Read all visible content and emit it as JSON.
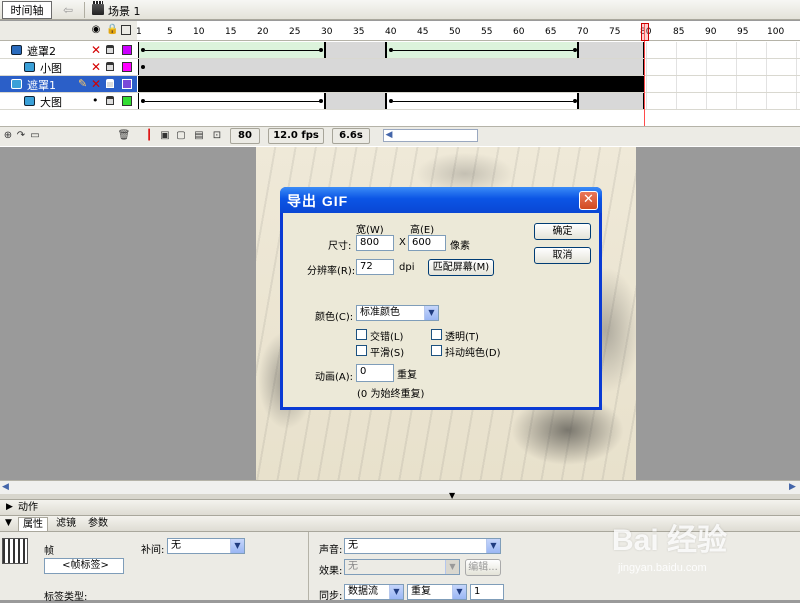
{
  "toolbar": {
    "timeline_label": "时间轴",
    "scene_label": "场景 1"
  },
  "timeline": {
    "ruler_ticks": [
      "1",
      "5",
      "10",
      "15",
      "20",
      "25",
      "30",
      "35",
      "40",
      "45",
      "50",
      "55",
      "60",
      "65",
      "70",
      "75",
      "80",
      "85",
      "90",
      "95",
      "100"
    ],
    "current_frame": "80",
    "fps": "12.0 fps",
    "elapsed": "6.6s",
    "layers": [
      {
        "name": "遮罩2",
        "type": "mask",
        "color": "#cc00ff"
      },
      {
        "name": "小图",
        "type": "masked",
        "color": "#ff00ff"
      },
      {
        "name": "遮罩1",
        "type": "mask",
        "color": "#7b49d9",
        "selected": true
      },
      {
        "name": "大图",
        "type": "masked",
        "color": "#33dd33"
      }
    ]
  },
  "dialog": {
    "title": "导出 GIF",
    "width_header": "宽(W)",
    "height_header": "高(E)",
    "size_label": "尺寸:",
    "width_value": "800",
    "x_label": "X",
    "height_value": "600",
    "pixel_unit": "像素",
    "resolution_label": "分辨率(R):",
    "resolution_value": "72",
    "dpi_unit": "dpi",
    "match_screen_button": "匹配屏幕(M)",
    "ok_button": "确定",
    "cancel_button": "取消",
    "colors_label": "颜色(C):",
    "colors_value": "标准颜色",
    "interlace_label": "交错(L)",
    "transparent_label": "透明(T)",
    "smooth_label": "平滑(S)",
    "dither_label": "抖动纯色(D)",
    "animation_label": "动画(A):",
    "animation_value": "0",
    "repeat_label": "重复",
    "repeat_note": "(0 为始终重复)"
  },
  "panels": {
    "actions_tab": "动作",
    "properties_tab": "属性",
    "filters_tab": "滤镜",
    "parameters_tab": "参数",
    "frame_label": "帧",
    "frame_tag_placeholder": "<帧标签>",
    "label_type": "标签类型:",
    "tween_label": "补间:",
    "tween_value": "无",
    "sound_label": "声音:",
    "sound_value": "无",
    "effect_label": "效果:",
    "effect_value": "无",
    "edit_button": "编辑...",
    "sync_label": "同步:",
    "sync_value": "数据流",
    "repeat_value": "重复",
    "repeat_count": "1"
  },
  "watermark": {
    "text": "Bai 经验",
    "url": "jingyan.baidu.com"
  }
}
